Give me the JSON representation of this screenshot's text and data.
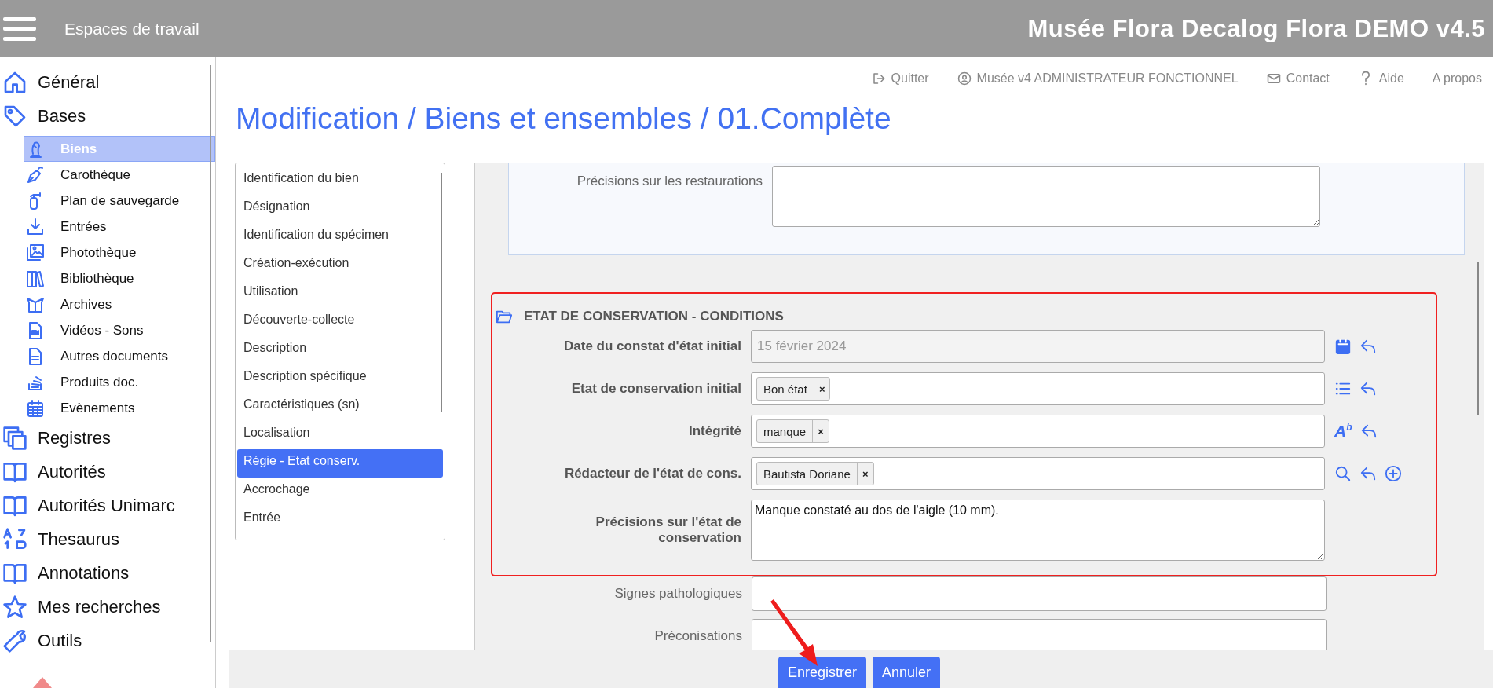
{
  "header": {
    "workspaces_label": "Espaces de travail",
    "app_title": "Musée Flora Decalog Flora DEMO v4.5"
  },
  "sidebar": {
    "items": [
      {
        "label": "Général",
        "selected": false
      },
      {
        "label": "Bases",
        "selected": false,
        "expanded": true,
        "children": [
          {
            "label": "Biens",
            "selected": true
          },
          {
            "label": "Carothèque",
            "selected": false
          },
          {
            "label": "Plan de sauvegarde",
            "selected": false
          },
          {
            "label": "Entrées",
            "selected": false
          },
          {
            "label": "Photothèque",
            "selected": false
          },
          {
            "label": "Bibliothèque",
            "selected": false
          },
          {
            "label": "Archives",
            "selected": false
          },
          {
            "label": "Vidéos - Sons",
            "selected": false
          },
          {
            "label": "Autres documents",
            "selected": false
          },
          {
            "label": "Produits doc.",
            "selected": false
          },
          {
            "label": "Evènements",
            "selected": false
          }
        ]
      },
      {
        "label": "Registres",
        "selected": false
      },
      {
        "label": "Autorités",
        "selected": false
      },
      {
        "label": "Autorités Unimarc",
        "selected": false
      },
      {
        "label": "Thesaurus",
        "selected": false
      },
      {
        "label": "Annotations",
        "selected": false
      },
      {
        "label": "Mes recherches",
        "selected": false
      },
      {
        "label": "Outils",
        "selected": false
      }
    ]
  },
  "top_links": [
    {
      "label": "Quitter"
    },
    {
      "label": "Musée v4 ADMINISTRATEUR FONCTIONNEL"
    },
    {
      "label": "Contact"
    },
    {
      "label": "Aide"
    },
    {
      "label": "A propos"
    }
  ],
  "page_title": "Modification / Biens et ensembles / 01.Complète",
  "section_nav": [
    {
      "label": "Identification du bien",
      "selected": false
    },
    {
      "label": "Désignation",
      "selected": false
    },
    {
      "label": "Identification du spécimen",
      "selected": false
    },
    {
      "label": "Création-exécution",
      "selected": false
    },
    {
      "label": "Utilisation",
      "selected": false
    },
    {
      "label": "Découverte-collecte",
      "selected": false
    },
    {
      "label": "Description",
      "selected": false
    },
    {
      "label": "Description spécifique",
      "selected": false
    },
    {
      "label": "Caractéristiques (sn)",
      "selected": false
    },
    {
      "label": "Localisation",
      "selected": false
    },
    {
      "label": "Régie - Etat conserv.",
      "selected": true
    },
    {
      "label": "Accrochage",
      "selected": false
    },
    {
      "label": "Entrée",
      "selected": false
    }
  ],
  "previous_section": {
    "fields": [
      {
        "label": "Précisions sur les restaurations",
        "kind": "textarea"
      }
    ]
  },
  "conservation_section": {
    "title": "ETAT DE CONSERVATION - CONDITIONS",
    "highlighted": true,
    "fields": [
      {
        "label": "Date du constat d'état initial",
        "kind": "date",
        "value": "15 février 2024",
        "disabled": true
      },
      {
        "label": "Etat de conservation initial",
        "kind": "list",
        "tags": [
          {
            "label": "Bon état",
            "remove": "×"
          }
        ]
      },
      {
        "label": "Intégrité",
        "kind": "thesaurus",
        "tags": [
          {
            "label": "manque",
            "remove": "×"
          }
        ],
        "style_button": "A$^{b}$"
      },
      {
        "label": "Rédacteur de l'état de cons.",
        "kind": "person",
        "tags": [
          {
            "label": "Bautista Doriane",
            "remove": "×"
          }
        ]
      },
      {
        "label": "Précisions sur l'état de conservation",
        "kind": "textarea",
        "value": "Manque constaté au dos de l'aigle (10 mm)."
      }
    ]
  },
  "other_fields": [
    {
      "label": "Signes pathologiques"
    },
    {
      "label": "Préconisations"
    }
  ],
  "buttons": [
    {
      "label": "Enregistrer"
    },
    {
      "label": "Annuler"
    }
  ]
}
